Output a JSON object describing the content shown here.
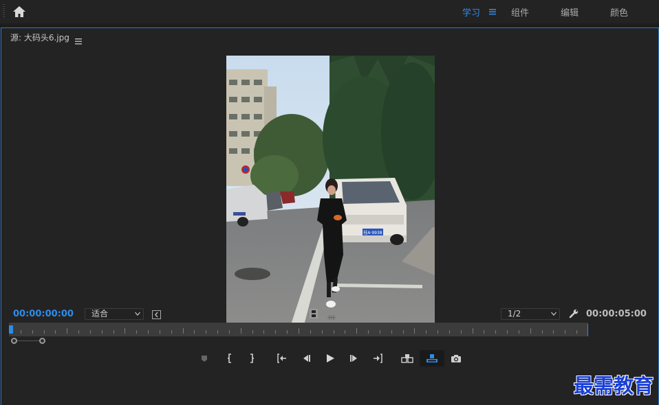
{
  "workspace": {
    "tabs": [
      {
        "label": "学习",
        "active": true
      },
      {
        "label": "组件",
        "active": false
      },
      {
        "label": "编辑",
        "active": false
      },
      {
        "label": "颜色",
        "active": false
      }
    ],
    "icons": {
      "home": "home-icon",
      "menu": "hamburger-menu-icon"
    }
  },
  "source_panel": {
    "title": "源: 大码头6.jpg",
    "image_subject": "woman in black walking on street with white van and trees",
    "van_plate": "桂A·9938"
  },
  "controls": {
    "timecode_current": "00:00:00:00",
    "timecode_duration": "00:00:05:00",
    "zoom_select": "适合",
    "resolution_select": "1/2"
  },
  "transport": [
    {
      "name": "add-marker-button",
      "icon": "marker-icon"
    },
    {
      "name": "mark-in-button",
      "icon": "mark-in-icon"
    },
    {
      "name": "mark-out-button",
      "icon": "mark-out-icon"
    },
    {
      "name": "go-to-in-button",
      "icon": "go-to-in-icon"
    },
    {
      "name": "step-back-button",
      "icon": "step-back-icon"
    },
    {
      "name": "play-button",
      "icon": "play-icon"
    },
    {
      "name": "step-forward-button",
      "icon": "step-forward-icon"
    },
    {
      "name": "go-to-out-button",
      "icon": "go-to-out-icon"
    },
    {
      "name": "insert-button",
      "icon": "insert-icon"
    },
    {
      "name": "overwrite-button",
      "icon": "overwrite-icon",
      "active": true
    },
    {
      "name": "export-frame-button",
      "icon": "camera-icon"
    }
  ],
  "watermark": "最需教育",
  "colors": {
    "accent": "#2d8ceb",
    "panel_bg": "#232323",
    "app_bg": "#1d1d1d"
  }
}
